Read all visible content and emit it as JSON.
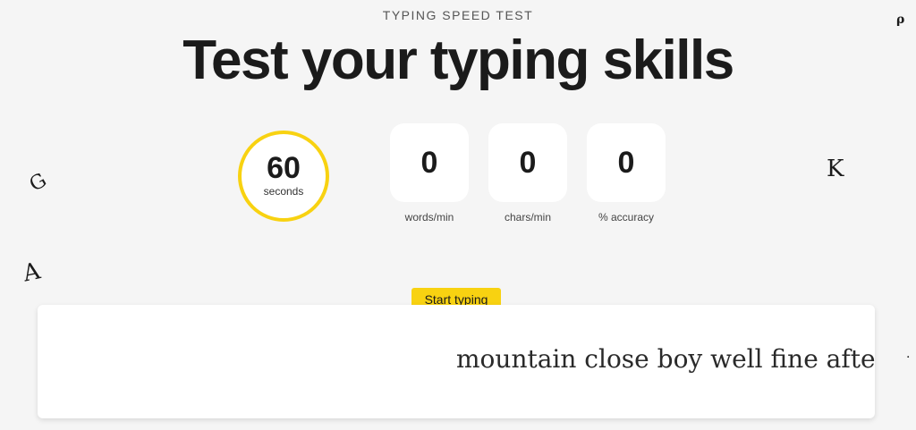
{
  "header": {
    "eyebrow": "TYPING SPEED TEST",
    "title": "Test your typing skills"
  },
  "timer": {
    "value": "60",
    "unit": "seconds"
  },
  "stats": [
    {
      "value": "0",
      "label": "words/min"
    },
    {
      "value": "0",
      "label": "chars/min"
    },
    {
      "value": "0",
      "label": "% accuracy"
    }
  ],
  "typing": {
    "tooltip": "Start typing",
    "text": "mountain close boy well fine afte"
  },
  "decorations": {
    "glyph_top_right": "ρ",
    "glyph_left_mid": "G",
    "glyph_right_mid": "K",
    "glyph_left_low": "A",
    "glyph_right_low": "·"
  },
  "colors": {
    "accent": "#f8d211",
    "background": "#f5f5f5",
    "card": "#ffffff",
    "text": "#1b1b1b"
  }
}
